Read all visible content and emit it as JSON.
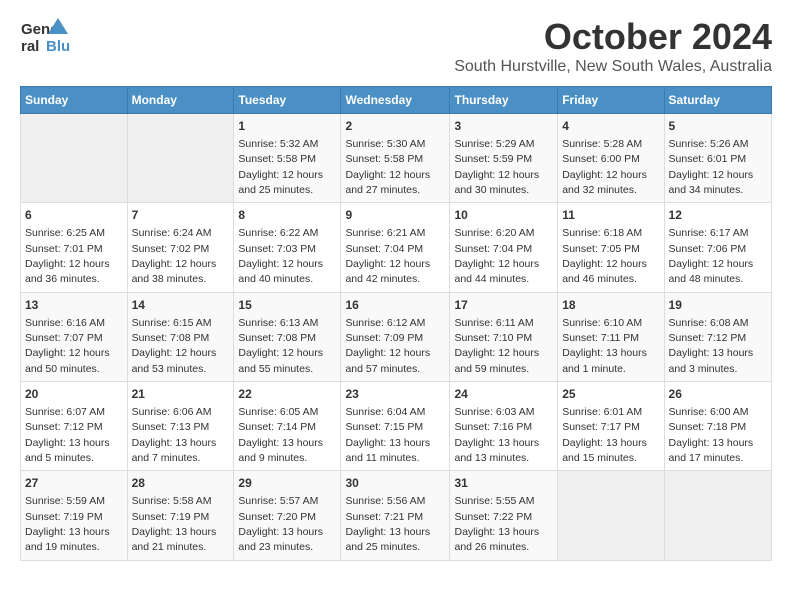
{
  "logo": {
    "line1": "General",
    "line2": "Blue"
  },
  "title": "October 2024",
  "location": "South Hurstville, New South Wales, Australia",
  "days_of_week": [
    "Sunday",
    "Monday",
    "Tuesday",
    "Wednesday",
    "Thursday",
    "Friday",
    "Saturday"
  ],
  "weeks": [
    [
      {
        "day": null
      },
      {
        "day": null
      },
      {
        "day": 1,
        "sunrise": "5:32 AM",
        "sunset": "5:58 PM",
        "daylight": "12 hours and 25 minutes."
      },
      {
        "day": 2,
        "sunrise": "5:30 AM",
        "sunset": "5:58 PM",
        "daylight": "12 hours and 27 minutes."
      },
      {
        "day": 3,
        "sunrise": "5:29 AM",
        "sunset": "5:59 PM",
        "daylight": "12 hours and 30 minutes."
      },
      {
        "day": 4,
        "sunrise": "5:28 AM",
        "sunset": "6:00 PM",
        "daylight": "12 hours and 32 minutes."
      },
      {
        "day": 5,
        "sunrise": "5:26 AM",
        "sunset": "6:01 PM",
        "daylight": "12 hours and 34 minutes."
      }
    ],
    [
      {
        "day": 6,
        "sunrise": "6:25 AM",
        "sunset": "7:01 PM",
        "daylight": "12 hours and 36 minutes."
      },
      {
        "day": 7,
        "sunrise": "6:24 AM",
        "sunset": "7:02 PM",
        "daylight": "12 hours and 38 minutes."
      },
      {
        "day": 8,
        "sunrise": "6:22 AM",
        "sunset": "7:03 PM",
        "daylight": "12 hours and 40 minutes."
      },
      {
        "day": 9,
        "sunrise": "6:21 AM",
        "sunset": "7:04 PM",
        "daylight": "12 hours and 42 minutes."
      },
      {
        "day": 10,
        "sunrise": "6:20 AM",
        "sunset": "7:04 PM",
        "daylight": "12 hours and 44 minutes."
      },
      {
        "day": 11,
        "sunrise": "6:18 AM",
        "sunset": "7:05 PM",
        "daylight": "12 hours and 46 minutes."
      },
      {
        "day": 12,
        "sunrise": "6:17 AM",
        "sunset": "7:06 PM",
        "daylight": "12 hours and 48 minutes."
      }
    ],
    [
      {
        "day": 13,
        "sunrise": "6:16 AM",
        "sunset": "7:07 PM",
        "daylight": "12 hours and 50 minutes."
      },
      {
        "day": 14,
        "sunrise": "6:15 AM",
        "sunset": "7:08 PM",
        "daylight": "12 hours and 53 minutes."
      },
      {
        "day": 15,
        "sunrise": "6:13 AM",
        "sunset": "7:08 PM",
        "daylight": "12 hours and 55 minutes."
      },
      {
        "day": 16,
        "sunrise": "6:12 AM",
        "sunset": "7:09 PM",
        "daylight": "12 hours and 57 minutes."
      },
      {
        "day": 17,
        "sunrise": "6:11 AM",
        "sunset": "7:10 PM",
        "daylight": "12 hours and 59 minutes."
      },
      {
        "day": 18,
        "sunrise": "6:10 AM",
        "sunset": "7:11 PM",
        "daylight": "13 hours and 1 minute."
      },
      {
        "day": 19,
        "sunrise": "6:08 AM",
        "sunset": "7:12 PM",
        "daylight": "13 hours and 3 minutes."
      }
    ],
    [
      {
        "day": 20,
        "sunrise": "6:07 AM",
        "sunset": "7:12 PM",
        "daylight": "13 hours and 5 minutes."
      },
      {
        "day": 21,
        "sunrise": "6:06 AM",
        "sunset": "7:13 PM",
        "daylight": "13 hours and 7 minutes."
      },
      {
        "day": 22,
        "sunrise": "6:05 AM",
        "sunset": "7:14 PM",
        "daylight": "13 hours and 9 minutes."
      },
      {
        "day": 23,
        "sunrise": "6:04 AM",
        "sunset": "7:15 PM",
        "daylight": "13 hours and 11 minutes."
      },
      {
        "day": 24,
        "sunrise": "6:03 AM",
        "sunset": "7:16 PM",
        "daylight": "13 hours and 13 minutes."
      },
      {
        "day": 25,
        "sunrise": "6:01 AM",
        "sunset": "7:17 PM",
        "daylight": "13 hours and 15 minutes."
      },
      {
        "day": 26,
        "sunrise": "6:00 AM",
        "sunset": "7:18 PM",
        "daylight": "13 hours and 17 minutes."
      }
    ],
    [
      {
        "day": 27,
        "sunrise": "5:59 AM",
        "sunset": "7:19 PM",
        "daylight": "13 hours and 19 minutes."
      },
      {
        "day": 28,
        "sunrise": "5:58 AM",
        "sunset": "7:19 PM",
        "daylight": "13 hours and 21 minutes."
      },
      {
        "day": 29,
        "sunrise": "5:57 AM",
        "sunset": "7:20 PM",
        "daylight": "13 hours and 23 minutes."
      },
      {
        "day": 30,
        "sunrise": "5:56 AM",
        "sunset": "7:21 PM",
        "daylight": "13 hours and 25 minutes."
      },
      {
        "day": 31,
        "sunrise": "5:55 AM",
        "sunset": "7:22 PM",
        "daylight": "13 hours and 26 minutes."
      },
      {
        "day": null
      },
      {
        "day": null
      }
    ]
  ]
}
